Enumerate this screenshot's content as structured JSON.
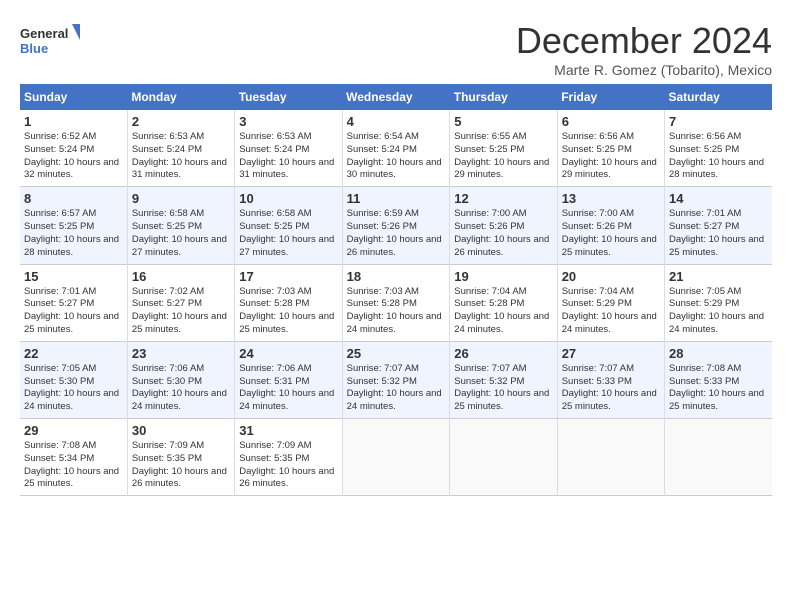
{
  "header": {
    "logo_line1": "General",
    "logo_line2": "Blue",
    "month_title": "December 2024",
    "location": "Marte R. Gomez (Tobarito), Mexico"
  },
  "weekdays": [
    "Sunday",
    "Monday",
    "Tuesday",
    "Wednesday",
    "Thursday",
    "Friday",
    "Saturday"
  ],
  "weeks": [
    [
      {
        "day": "1",
        "sunrise": "6:52 AM",
        "sunset": "5:24 PM",
        "daylight": "10 hours and 32 minutes."
      },
      {
        "day": "2",
        "sunrise": "6:53 AM",
        "sunset": "5:24 PM",
        "daylight": "10 hours and 31 minutes."
      },
      {
        "day": "3",
        "sunrise": "6:53 AM",
        "sunset": "5:24 PM",
        "daylight": "10 hours and 31 minutes."
      },
      {
        "day": "4",
        "sunrise": "6:54 AM",
        "sunset": "5:24 PM",
        "daylight": "10 hours and 30 minutes."
      },
      {
        "day": "5",
        "sunrise": "6:55 AM",
        "sunset": "5:25 PM",
        "daylight": "10 hours and 29 minutes."
      },
      {
        "day": "6",
        "sunrise": "6:56 AM",
        "sunset": "5:25 PM",
        "daylight": "10 hours and 29 minutes."
      },
      {
        "day": "7",
        "sunrise": "6:56 AM",
        "sunset": "5:25 PM",
        "daylight": "10 hours and 28 minutes."
      }
    ],
    [
      {
        "day": "8",
        "sunrise": "6:57 AM",
        "sunset": "5:25 PM",
        "daylight": "10 hours and 28 minutes."
      },
      {
        "day": "9",
        "sunrise": "6:58 AM",
        "sunset": "5:25 PM",
        "daylight": "10 hours and 27 minutes."
      },
      {
        "day": "10",
        "sunrise": "6:58 AM",
        "sunset": "5:25 PM",
        "daylight": "10 hours and 27 minutes."
      },
      {
        "day": "11",
        "sunrise": "6:59 AM",
        "sunset": "5:26 PM",
        "daylight": "10 hours and 26 minutes."
      },
      {
        "day": "12",
        "sunrise": "7:00 AM",
        "sunset": "5:26 PM",
        "daylight": "10 hours and 26 minutes."
      },
      {
        "day": "13",
        "sunrise": "7:00 AM",
        "sunset": "5:26 PM",
        "daylight": "10 hours and 25 minutes."
      },
      {
        "day": "14",
        "sunrise": "7:01 AM",
        "sunset": "5:27 PM",
        "daylight": "10 hours and 25 minutes."
      }
    ],
    [
      {
        "day": "15",
        "sunrise": "7:01 AM",
        "sunset": "5:27 PM",
        "daylight": "10 hours and 25 minutes."
      },
      {
        "day": "16",
        "sunrise": "7:02 AM",
        "sunset": "5:27 PM",
        "daylight": "10 hours and 25 minutes."
      },
      {
        "day": "17",
        "sunrise": "7:03 AM",
        "sunset": "5:28 PM",
        "daylight": "10 hours and 25 minutes."
      },
      {
        "day": "18",
        "sunrise": "7:03 AM",
        "sunset": "5:28 PM",
        "daylight": "10 hours and 24 minutes."
      },
      {
        "day": "19",
        "sunrise": "7:04 AM",
        "sunset": "5:28 PM",
        "daylight": "10 hours and 24 minutes."
      },
      {
        "day": "20",
        "sunrise": "7:04 AM",
        "sunset": "5:29 PM",
        "daylight": "10 hours and 24 minutes."
      },
      {
        "day": "21",
        "sunrise": "7:05 AM",
        "sunset": "5:29 PM",
        "daylight": "10 hours and 24 minutes."
      }
    ],
    [
      {
        "day": "22",
        "sunrise": "7:05 AM",
        "sunset": "5:30 PM",
        "daylight": "10 hours and 24 minutes."
      },
      {
        "day": "23",
        "sunrise": "7:06 AM",
        "sunset": "5:30 PM",
        "daylight": "10 hours and 24 minutes."
      },
      {
        "day": "24",
        "sunrise": "7:06 AM",
        "sunset": "5:31 PM",
        "daylight": "10 hours and 24 minutes."
      },
      {
        "day": "25",
        "sunrise": "7:07 AM",
        "sunset": "5:32 PM",
        "daylight": "10 hours and 24 minutes."
      },
      {
        "day": "26",
        "sunrise": "7:07 AM",
        "sunset": "5:32 PM",
        "daylight": "10 hours and 25 minutes."
      },
      {
        "day": "27",
        "sunrise": "7:07 AM",
        "sunset": "5:33 PM",
        "daylight": "10 hours and 25 minutes."
      },
      {
        "day": "28",
        "sunrise": "7:08 AM",
        "sunset": "5:33 PM",
        "daylight": "10 hours and 25 minutes."
      }
    ],
    [
      {
        "day": "29",
        "sunrise": "7:08 AM",
        "sunset": "5:34 PM",
        "daylight": "10 hours and 25 minutes."
      },
      {
        "day": "30",
        "sunrise": "7:09 AM",
        "sunset": "5:35 PM",
        "daylight": "10 hours and 26 minutes."
      },
      {
        "day": "31",
        "sunrise": "7:09 AM",
        "sunset": "5:35 PM",
        "daylight": "10 hours and 26 minutes."
      },
      null,
      null,
      null,
      null
    ]
  ]
}
